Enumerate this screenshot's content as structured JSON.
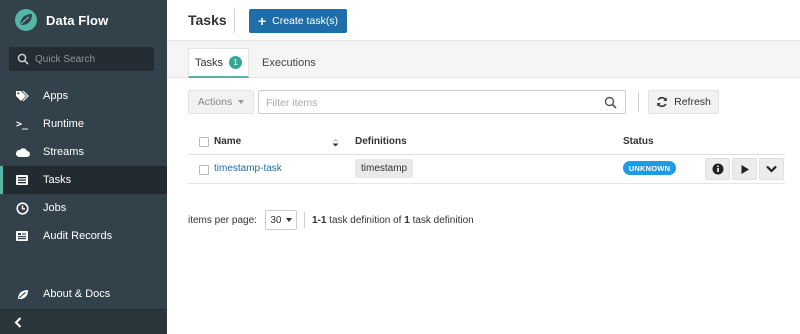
{
  "app": {
    "name": "Data Flow"
  },
  "sidebar": {
    "search_placeholder": "Quick Search",
    "items": [
      {
        "label": "Apps",
        "icon": "tags-icon",
        "active": false
      },
      {
        "label": "Runtime",
        "icon": "terminal-icon",
        "active": false
      },
      {
        "label": "Streams",
        "icon": "cloud-icon",
        "active": false
      },
      {
        "label": "Tasks",
        "icon": "tasks-icon",
        "active": true
      },
      {
        "label": "Jobs",
        "icon": "clock-icon",
        "active": false
      },
      {
        "label": "Audit Records",
        "icon": "audit-icon",
        "active": false
      }
    ],
    "about_label": "About & Docs"
  },
  "header": {
    "title": "Tasks",
    "create_label": "Create task(s)"
  },
  "tabs": [
    {
      "label": "Tasks",
      "badge": "1",
      "active": true
    },
    {
      "label": "Executions",
      "active": false
    }
  ],
  "toolbar": {
    "actions_label": "Actions",
    "filter_placeholder": "Filter items",
    "refresh_label": "Refresh"
  },
  "table": {
    "columns": {
      "name": "Name",
      "definitions": "Definitions",
      "status": "Status"
    },
    "rows": [
      {
        "name": "timestamp-task",
        "definition": "timestamp",
        "status": "UNKNOWN"
      }
    ]
  },
  "pagination": {
    "label": "items per page:",
    "per_page": "30",
    "range": "1-1",
    "middle": "task definition of",
    "total": "1",
    "suffix": "task definition"
  },
  "colors": {
    "sidebar": "#33414a",
    "accent": "#57b6a5",
    "primary": "#1f6eaa",
    "status_unknown": "#1e9be6"
  }
}
